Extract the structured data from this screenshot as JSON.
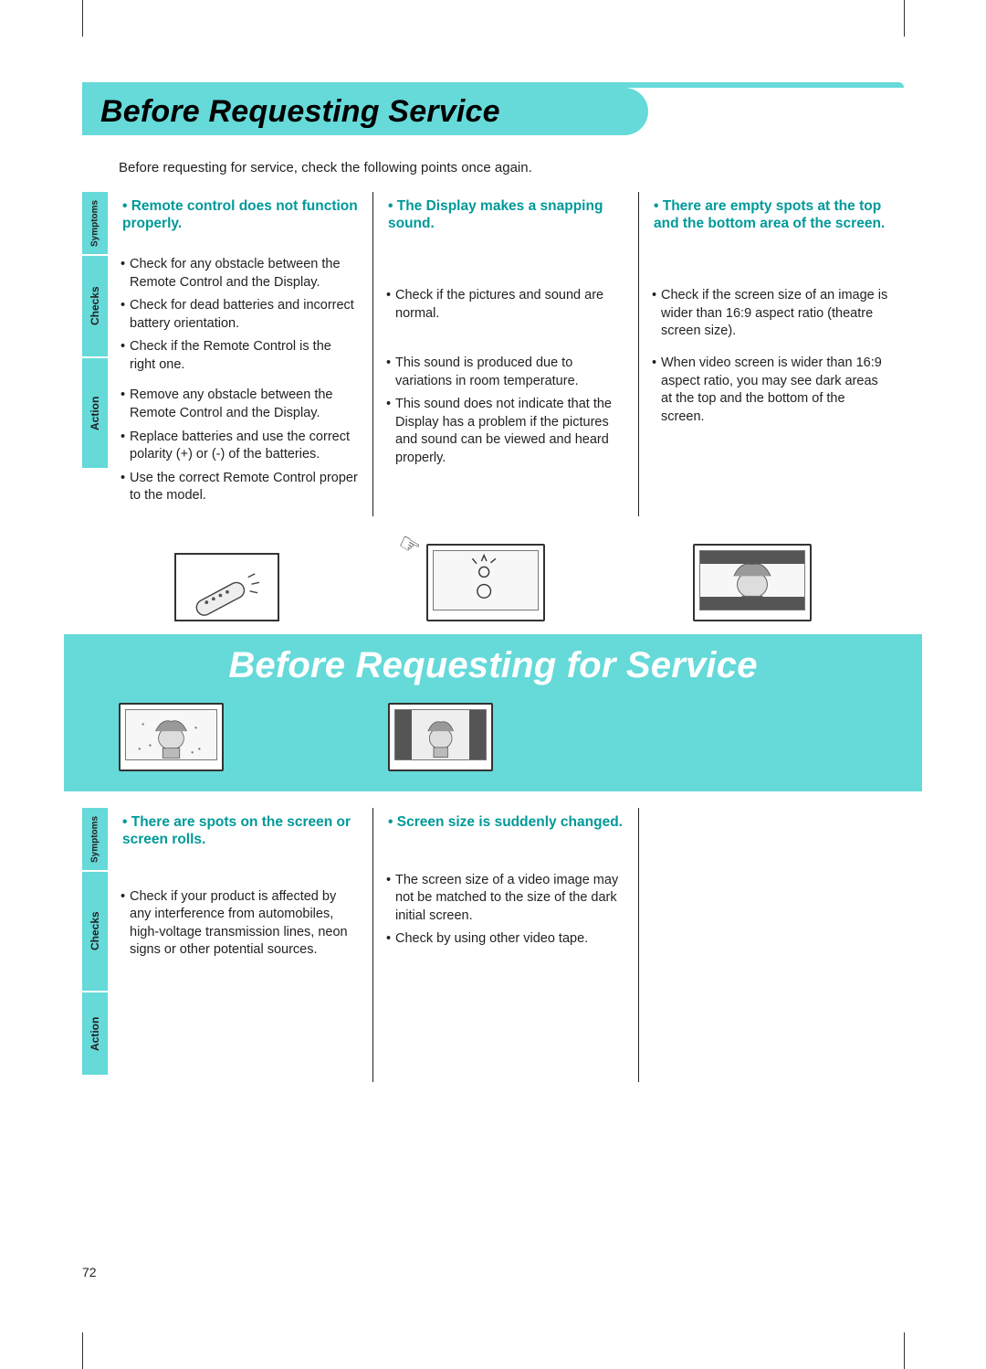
{
  "title": "Before Requesting Service",
  "intro": "Before requesting for service, check the following points once again.",
  "sideLabels": {
    "symptoms": "Symptoms",
    "checks": "Checks",
    "action": "Action"
  },
  "top": {
    "col1": {
      "symptom": "Remote control does not function properly.",
      "checks": [
        "Check for any obstacle between the Remote Control and the Display.",
        "Check for dead batteries and incorrect battery orientation.",
        "Check if the Remote Control is the right one."
      ],
      "action": [
        "Remove any obstacle between the Remote Control and the Display.",
        "Replace batteries and use the correct polarity (+) or (-) of the batteries.",
        "Use the correct Remote Control proper to the model."
      ]
    },
    "col2": {
      "symptom": "The Display makes a snapping sound.",
      "checks": [
        "Check if the pictures and sound are normal."
      ],
      "action": [
        "This sound is produced due to variations in room temperature.",
        "This sound does not indicate that the Display has a problem if the pictures and sound can be viewed and heard properly."
      ]
    },
    "col3": {
      "symptom": "There are empty spots at the top and the bottom area of the screen.",
      "checks": [
        "Check if the screen size of an image is wider than 16:9 aspect ratio (theatre screen size)."
      ],
      "action": [
        "When video screen is wider than 16:9 aspect ratio, you may see dark areas at the top and the bottom of the screen."
      ]
    }
  },
  "bannerTitle": "Before Requesting for Service",
  "bottom": {
    "col1": {
      "symptom": "There are spots on the screen or screen rolls.",
      "checks": [
        "Check if your product is affected by any interference from automobiles, high-voltage transmission lines, neon signs or other potential sources."
      ],
      "action": []
    },
    "col2": {
      "symptom": "Screen size is suddenly changed.",
      "checks": [
        "The screen size of a video image may not be matched to the size of the dark initial screen.",
        "Check by using other video tape."
      ],
      "action": []
    }
  },
  "pageNumber": "72"
}
